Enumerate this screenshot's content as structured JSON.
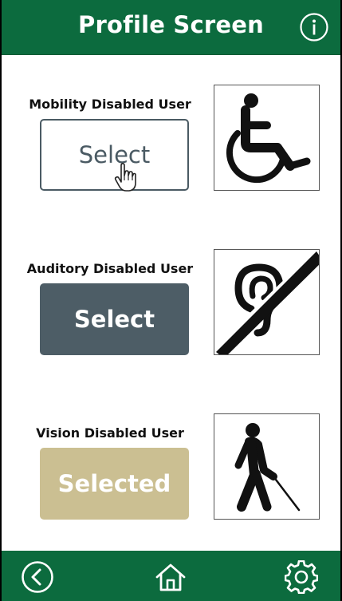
{
  "header": {
    "title": "Profile Screen"
  },
  "profiles": [
    {
      "label": "Mobility Disabled User",
      "button_label": "Select",
      "icon": "wheelchair-icon"
    },
    {
      "label": "Auditory Disabled User",
      "button_label": "Select",
      "icon": "hearing-impaired-icon"
    },
    {
      "label": "Vision Disabled User",
      "button_label": "Selected",
      "icon": "blind-person-icon"
    }
  ],
  "footer": {
    "icons": [
      "back-icon",
      "home-icon",
      "settings-icon"
    ]
  },
  "colors": {
    "brand_green": "#0c6b3e",
    "slate": "#4d5d66",
    "selected_tan": "#cbbf92"
  }
}
